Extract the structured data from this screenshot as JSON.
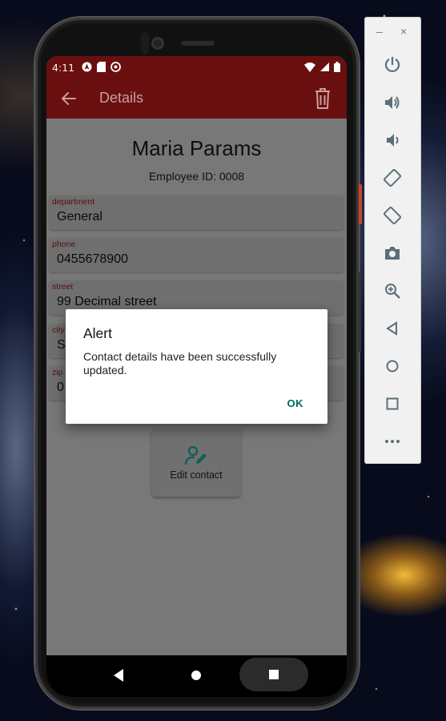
{
  "status_bar": {
    "time": "4:11"
  },
  "app_bar": {
    "title": "Details"
  },
  "contact": {
    "name": "Maria Params",
    "employee_id_text": "Employee ID: 0008",
    "fields": [
      {
        "label": "department",
        "value": "General"
      },
      {
        "label": "phone",
        "value": "0455678900"
      },
      {
        "label": "street",
        "value": "99 Decimal street"
      },
      {
        "label": "city",
        "value": "S"
      },
      {
        "label": "zip",
        "value": "0"
      }
    ]
  },
  "edit_button": {
    "label": "Edit contact"
  },
  "dialog": {
    "title": "Alert",
    "message": "Contact details have been successfully updated.",
    "ok_label": "OK"
  },
  "emulator_toolbar": {
    "minimize": "–",
    "close": "×",
    "items": [
      "power-icon",
      "volume-up-icon",
      "volume-down-icon",
      "rotate-left-icon",
      "rotate-right-icon",
      "camera-icon",
      "zoom-icon",
      "back-icon",
      "home-icon",
      "overview-icon",
      "more-icon"
    ]
  },
  "colors": {
    "app_bar": "#6a0f0f",
    "accent_teal": "#00695c",
    "field_label": "#5b0c0c"
  }
}
